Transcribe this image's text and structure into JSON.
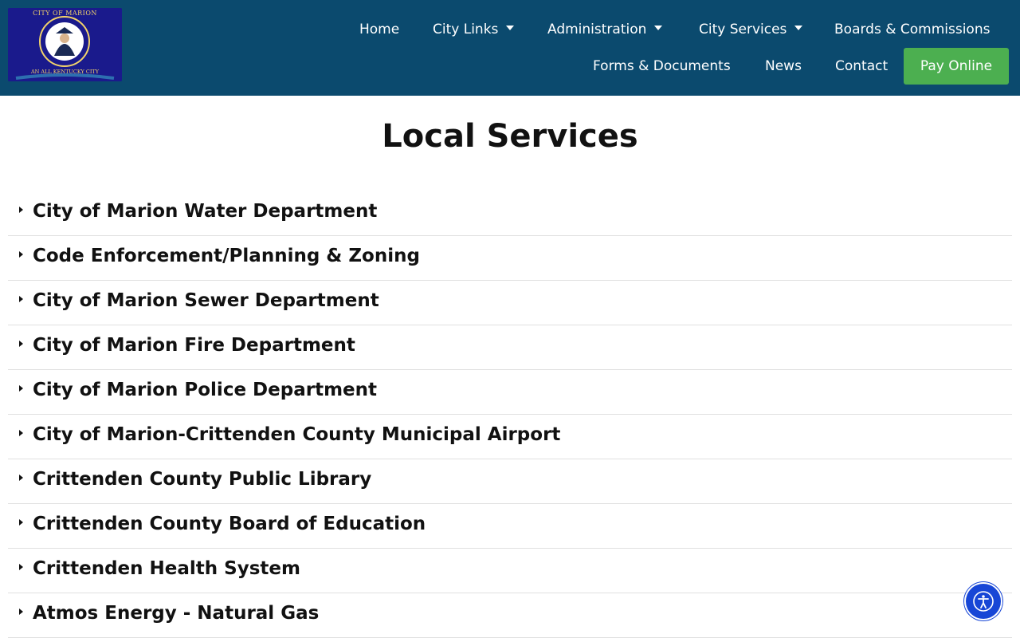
{
  "header": {
    "logo": {
      "top_text": "CITY OF MARION",
      "bottom_text": "AN ALL KENTUCKY CITY",
      "colors": {
        "field": "#1a1a8c",
        "gold": "#f2d36b"
      }
    },
    "nav": {
      "home": "Home",
      "city_links": "City Links",
      "administration": "Administration",
      "city_services": "City Services",
      "boards": "Boards & Commissions",
      "forms": "Forms & Documents",
      "news": "News",
      "contact": "Contact",
      "pay_online": "Pay Online"
    },
    "colors": {
      "header_bg": "#0b4a6e",
      "pay_button": "#4caf50"
    }
  },
  "main": {
    "title": "Local Services",
    "items": [
      {
        "label": "City of Marion Water Department"
      },
      {
        "label": "Code Enforcement/Planning & Zoning"
      },
      {
        "label": "City of Marion Sewer Department"
      },
      {
        "label": "City of Marion Fire Department"
      },
      {
        "label": "City of Marion Police Department"
      },
      {
        "label": "City of Marion-Crittenden County Municipal Airport"
      },
      {
        "label": "Crittenden County Public Library"
      },
      {
        "label": "Crittenden County Board of Education"
      },
      {
        "label": "Crittenden Health System"
      },
      {
        "label": "Atmos Energy - Natural Gas"
      }
    ]
  },
  "accessibility": {
    "icon": "accessibility-icon",
    "color": "#1746d6"
  }
}
